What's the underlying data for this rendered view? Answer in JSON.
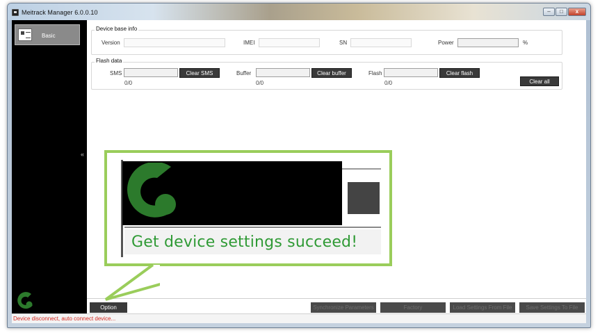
{
  "window": {
    "title": "Meitrack Manager 6.0.0.10",
    "minimize": "–",
    "maximize": "□",
    "close": "x"
  },
  "sidebar": {
    "items": [
      {
        "label": "Basic"
      }
    ],
    "collapse": "«"
  },
  "device_info": {
    "title": "Device base info",
    "version_label": "Version",
    "imei_label": "IMEI",
    "sn_label": "SN",
    "power_label": "Power",
    "power_unit": "%",
    "power_level": 0
  },
  "flash_data": {
    "title": "Flash data",
    "sms_label": "SMS",
    "sms_button": "Clear SMS",
    "sms_count": "0/0",
    "sms_progress": 0,
    "buffer_label": "Buffer",
    "buffer_button": "Clear buffer",
    "buffer_count": "0/0",
    "buffer_progress": 0,
    "flash_label": "Flash",
    "flash_button": "Clear flash",
    "flash_count": "0/0",
    "flash_progress": 0,
    "clear_all": "Clear all"
  },
  "bottom_bar": {
    "option": "Option",
    "sync": "Synchronize Parameters",
    "factory": "Factory",
    "load": "Load Settings From File",
    "save": "Save Settings To File"
  },
  "status_bar": {
    "text": "Device disconnect, auto connect device..."
  },
  "callout": {
    "message": "Get device settings succeed!"
  },
  "colors": {
    "callout_border": "#9acd5b",
    "success_text": "#2f9a35",
    "status_error": "#d4271f",
    "logo_green": "#2c7a2c"
  }
}
